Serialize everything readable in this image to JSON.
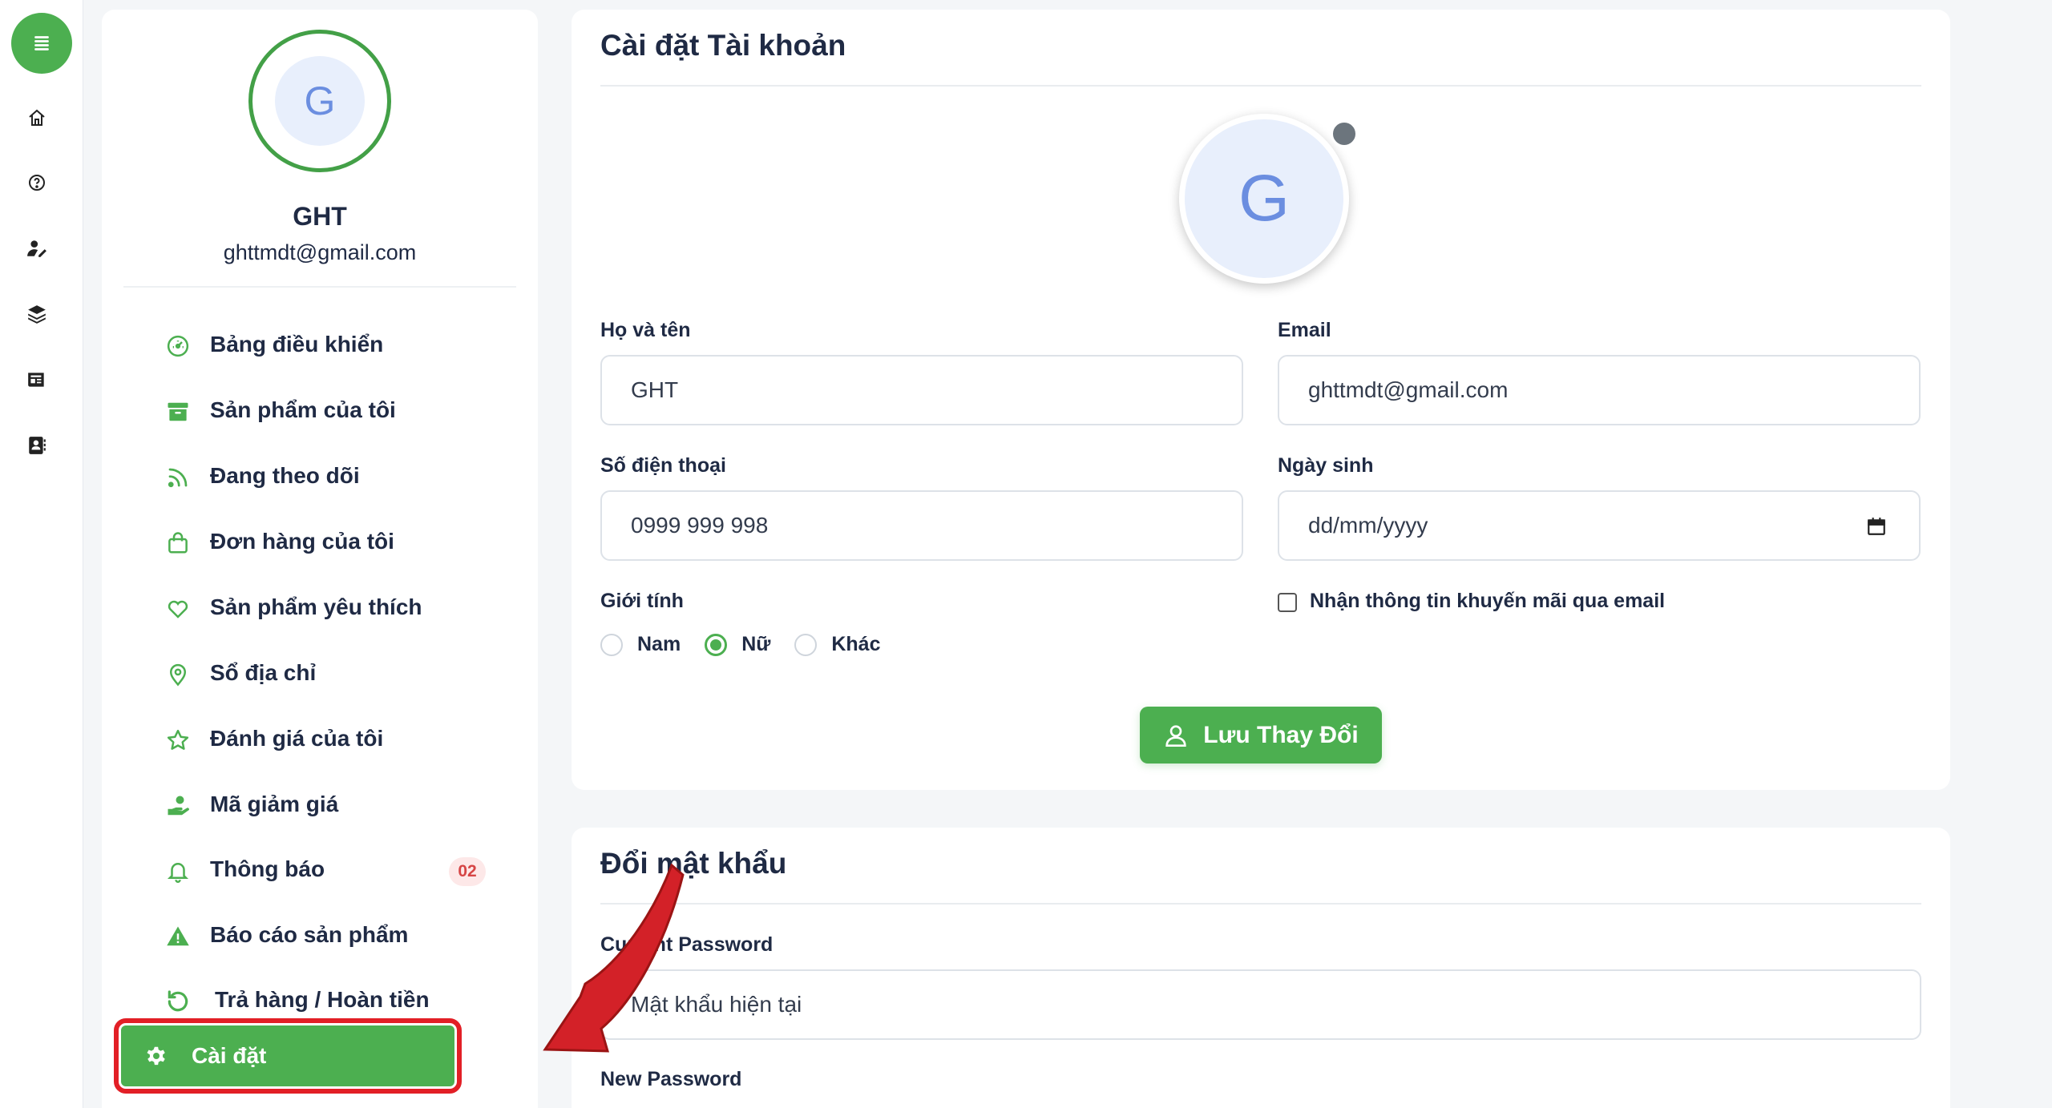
{
  "rail": {
    "icons": [
      "menu-icon",
      "home-icon",
      "help-icon",
      "user-edit-icon",
      "layers-icon",
      "newspaper-icon",
      "contact-card-icon"
    ]
  },
  "profile": {
    "avatar_letter": "G",
    "name": "GHT",
    "email": "ghttmdt@gmail.com"
  },
  "menu": [
    {
      "label": "Bảng điều khiển",
      "icon": "dashboard-icon"
    },
    {
      "label": "Sản phẩm của tôi",
      "icon": "archive-icon"
    },
    {
      "label": "Đang theo dõi",
      "icon": "rss-icon"
    },
    {
      "label": "Đơn hàng của tôi",
      "icon": "shopping-bag-icon"
    },
    {
      "label": "Sản phẩm yêu thích",
      "icon": "heart-icon"
    },
    {
      "label": "Sổ địa chỉ",
      "icon": "map-pin-icon"
    },
    {
      "label": "Đánh giá của tôi",
      "icon": "star-icon"
    },
    {
      "label": "Mã giảm giá",
      "icon": "hand-coin-icon"
    },
    {
      "label": "Thông báo",
      "icon": "bell-icon",
      "badge": "02"
    },
    {
      "label": "Báo cáo sản phẩm",
      "icon": "warning-icon"
    },
    {
      "label": "Trả hàng / Hoàn tiền",
      "icon": "refund-icon"
    },
    {
      "label": "Cài đặt",
      "icon": "gear-icon",
      "active": true
    }
  ],
  "account": {
    "title": "Cài đặt Tài khoản",
    "avatar_letter": "G",
    "fullname_label": "Họ và tên",
    "fullname_value": "GHT",
    "email_label": "Email",
    "email_value": "ghttmdt@gmail.com",
    "phone_label": "Số điện thoại",
    "phone_value": "0999 999 998",
    "dob_label": "Ngày sinh",
    "dob_value": "dd/mm/yyyy",
    "gender_label": "Giới tính",
    "gender_options": [
      "Nam",
      "Nữ",
      "Khác"
    ],
    "gender_selected": "Nữ",
    "promo_label": "Nhận thông tin khuyến mãi qua email",
    "promo_checked": false,
    "save_label": "Lưu Thay Đổi"
  },
  "password": {
    "title": "Đổi mật khẩu",
    "current_label": "Current Password",
    "current_placeholder": "Mật khẩu hiện tại",
    "new_label": "New Password"
  },
  "colors": {
    "accent": "#4caf50",
    "highlight": "#e21f26",
    "badge_bg": "#fde8e8",
    "badge_text": "#d64545"
  }
}
